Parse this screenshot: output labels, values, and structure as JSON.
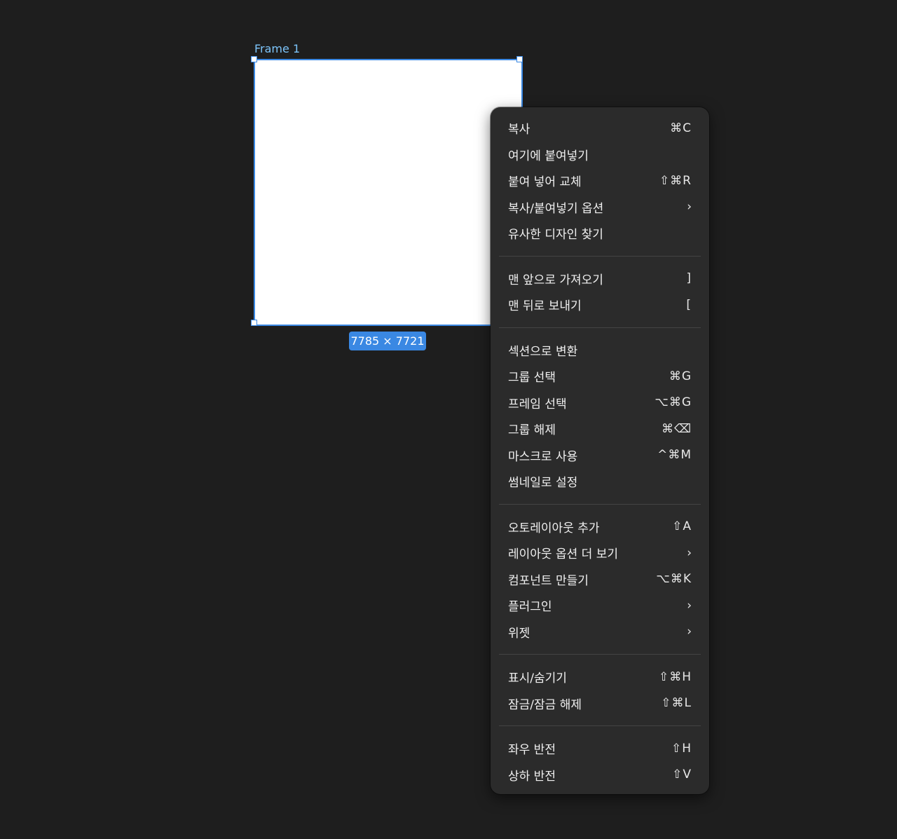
{
  "canvas": {
    "frame_label": "Frame 1",
    "dimensions": "7785 × 7721",
    "accent_color": "#3a88e3",
    "frame_label_color": "#7cc4fa",
    "background_color": "#1e1e1e"
  },
  "menu": {
    "groups": [
      [
        {
          "label": "복사",
          "shortcut": "⌘C"
        },
        {
          "label": "여기에 붙여넣기",
          "shortcut": ""
        },
        {
          "label": "붙여 넣어 교체",
          "shortcut": "⇧⌘R"
        },
        {
          "label": "복사/붙여넣기 옵션",
          "shortcut": "",
          "submenu": true
        },
        {
          "label": "유사한 디자인 찾기",
          "shortcut": ""
        }
      ],
      [
        {
          "label": "맨 앞으로 가져오기",
          "shortcut": "]"
        },
        {
          "label": "맨 뒤로 보내기",
          "shortcut": "["
        }
      ],
      [
        {
          "label": "섹션으로 변환",
          "shortcut": ""
        },
        {
          "label": "그룹 선택",
          "shortcut": "⌘G"
        },
        {
          "label": "프레임 선택",
          "shortcut": "⌥⌘G"
        },
        {
          "label": "그룹 해제",
          "shortcut": "⌘⌫"
        },
        {
          "label": "마스크로 사용",
          "shortcut": "^⌘M"
        },
        {
          "label": "썸네일로 설정",
          "shortcut": ""
        }
      ],
      [
        {
          "label": "오토레이아웃 추가",
          "shortcut": "⇧A"
        },
        {
          "label": "레이아웃 옵션 더 보기",
          "shortcut": "",
          "submenu": true
        },
        {
          "label": "컴포넌트 만들기",
          "shortcut": "⌥⌘K"
        },
        {
          "label": "플러그인",
          "shortcut": "",
          "submenu": true
        },
        {
          "label": "위젯",
          "shortcut": "",
          "submenu": true
        }
      ],
      [
        {
          "label": "표시/숨기기",
          "shortcut": "⇧⌘H"
        },
        {
          "label": "잠금/잠금 해제",
          "shortcut": "⇧⌘L"
        }
      ],
      [
        {
          "label": "좌우 반전",
          "shortcut": "⇧H"
        },
        {
          "label": "상하 반전",
          "shortcut": "⇧V"
        }
      ]
    ],
    "submenu_icon": "chevron-right-icon",
    "submenu_glyph": "›"
  }
}
